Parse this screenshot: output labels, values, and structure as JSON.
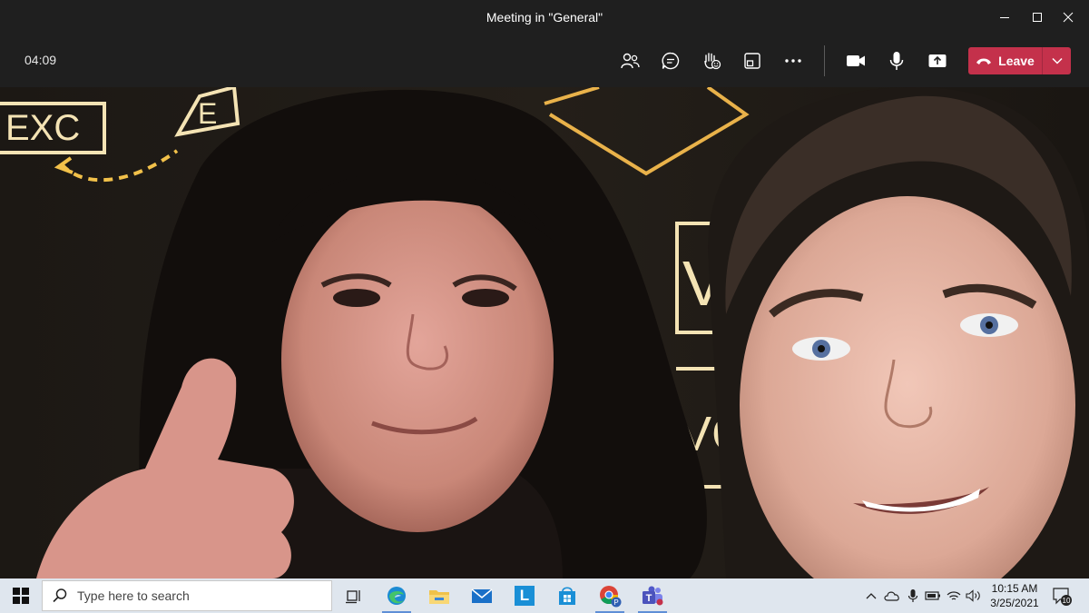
{
  "window": {
    "title": "Meeting in \"General\""
  },
  "toolbar": {
    "timer": "04:09",
    "icons": [
      "people-icon",
      "chat-icon",
      "raise-hand-icon",
      "rooms-icon",
      "more-icon",
      "camera-icon",
      "microphone-icon",
      "share-icon"
    ],
    "leave_label": "Leave",
    "leave_color": "#c4314b"
  },
  "taskbar": {
    "search_placeholder": "Type here to search",
    "apps": [
      "task-view",
      "edge",
      "file-explorer",
      "mail",
      "lexicon-app",
      "store",
      "chrome-profile",
      "teams"
    ],
    "lexicon_letter": "L",
    "chrome_profile_letter": "P",
    "time": "10:15 AM",
    "date": "3/25/2021",
    "notification_count": "10"
  },
  "background_sign_text": {
    "top_left": "EXC",
    "top_left_2": "E",
    "right_1": "V",
    "right_2": "VC"
  }
}
